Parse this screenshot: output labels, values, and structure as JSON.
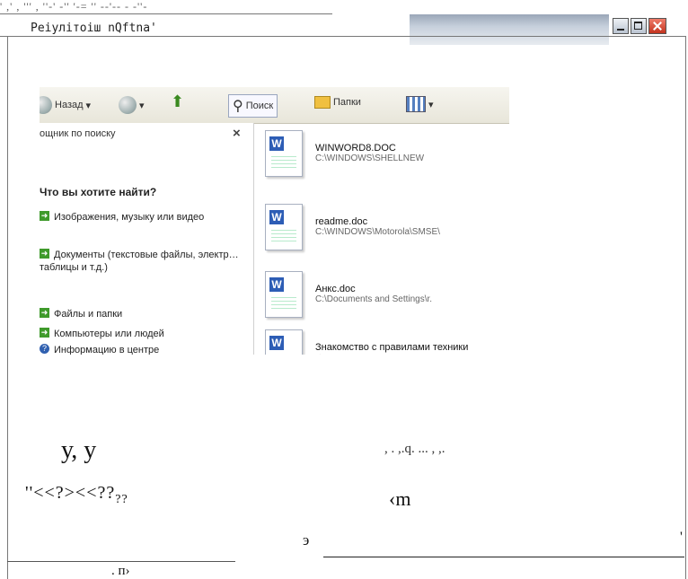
{
  "window": {
    "noise_text": "' ,' , ''' , ''-' -'' '-= '' --'-- - -''-",
    "title": "Реiулiтоiш nQftna'",
    "controls": [
      "minimize",
      "maximize",
      "close"
    ]
  },
  "explorer": {
    "toolbar": {
      "back": "Назад",
      "search": "Поиск",
      "folders": "Папки"
    },
    "pane": {
      "header": "ощник по поиску",
      "close": "×",
      "question": "Что вы хотите найти?",
      "options": [
        {
          "icon": "arrow-icon",
          "label": "Изображения, музыку или видео"
        },
        {
          "icon": "arrow-icon",
          "label": "Документы (текстовые файлы, электр… таблицы и т.д.)"
        },
        {
          "icon": "arrow-icon",
          "label": "Файлы и папки"
        },
        {
          "icon": "arrow-icon",
          "label": "Компьютеры или людей"
        },
        {
          "icon": "help-icon",
          "label": "Информацию в центре"
        }
      ]
    },
    "files": [
      {
        "name": "WINWORD8.DOC",
        "path": "C:\\WINDOWS\\SHELLNEW"
      },
      {
        "name": "readme.doc",
        "path": "C:\\WINDOWS\\Motorola\\SMSE\\"
      },
      {
        "name": "Анкс.doc",
        "path": "C:\\Documents and Settings\\r."
      },
      {
        "name": "Знакомство с правилами техники безопасности.doc",
        "path": ""
      }
    ]
  },
  "scribbles": {
    "y": "у, у",
    "q": ", . ,.q. ... , ,.",
    "quotes": "''<<?><<??",
    "quotes_sub": "??",
    "m": "‹m",
    "e": "э",
    "apos": "'",
    "p": ". п›"
  }
}
